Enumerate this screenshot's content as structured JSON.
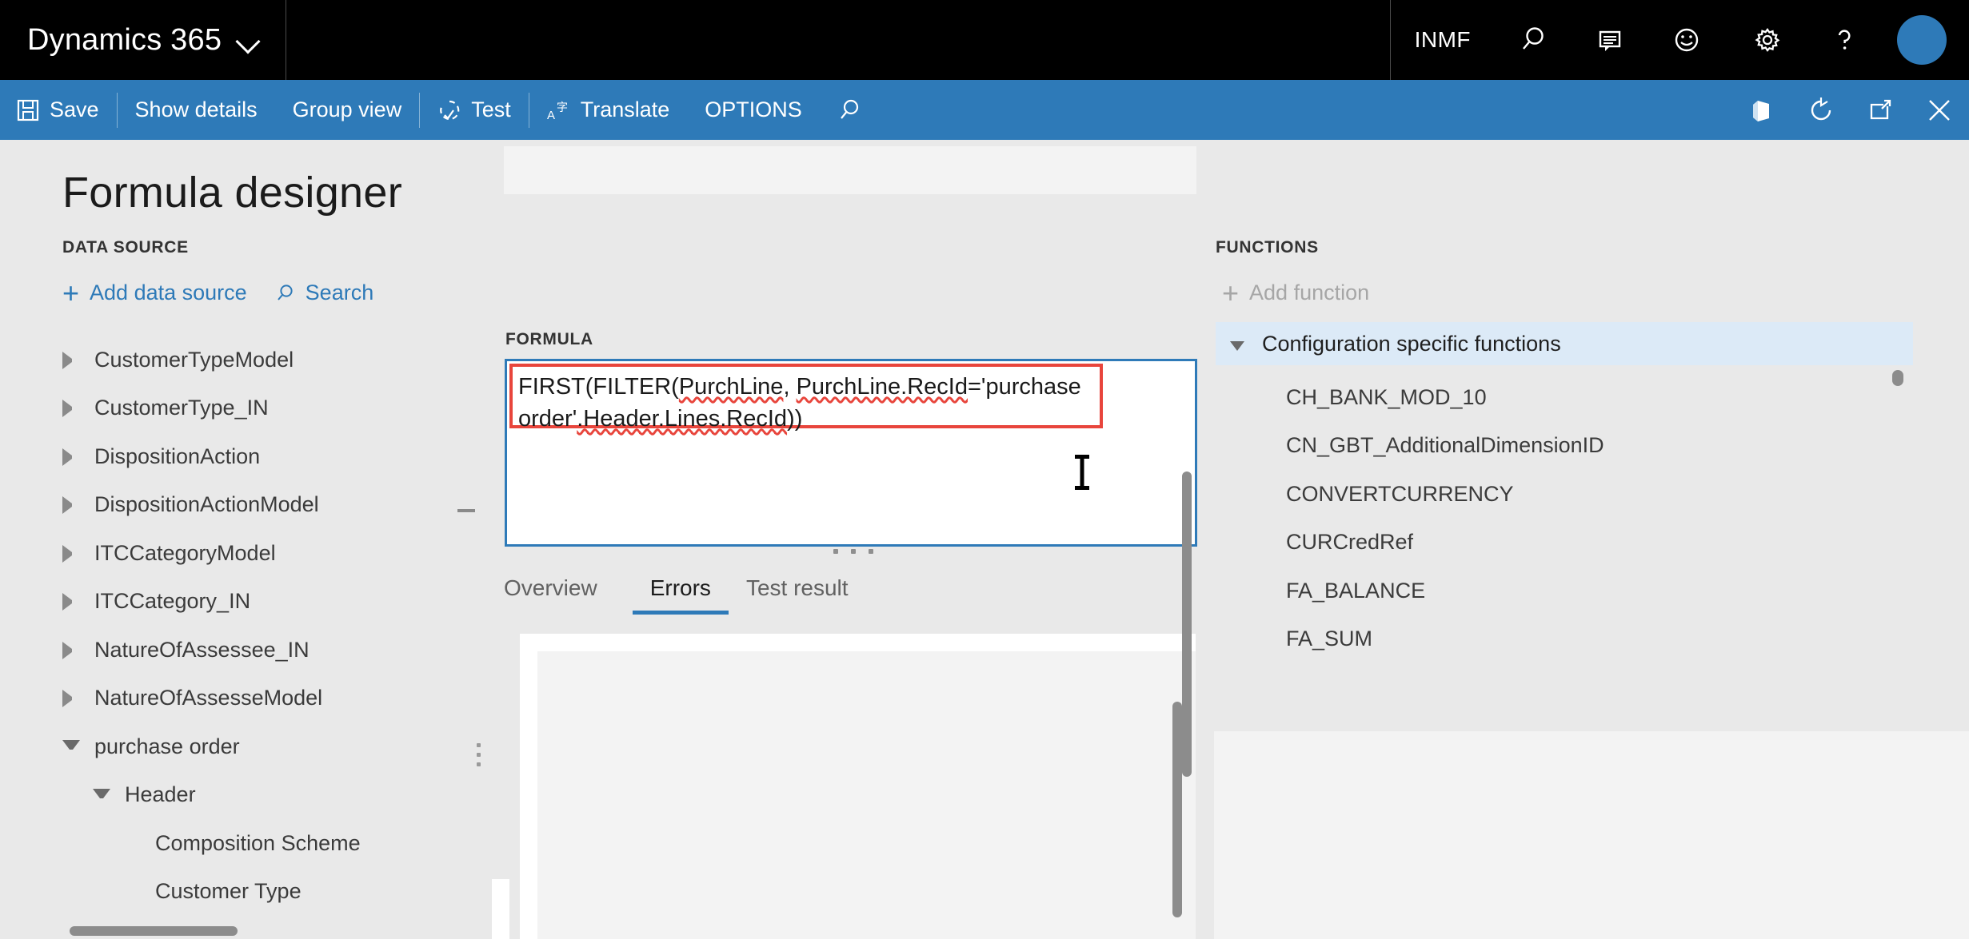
{
  "navbar": {
    "brand": "Dynamics 365",
    "company": "INMF",
    "icons": {
      "brand_chevron": "chevron-down-icon",
      "search": "search-icon",
      "feedback": "message-icon",
      "smiley": "smiley-icon",
      "settings": "gear-icon",
      "help": "question-mark-icon",
      "avatar": "user-avatar"
    }
  },
  "commandbar": {
    "save": "Save",
    "show_details": "Show details",
    "group_view": "Group view",
    "test": "Test",
    "translate": "Translate",
    "options": "OPTIONS",
    "search_icon": "search-icon",
    "office_icon": "office-icon",
    "refresh_icon": "refresh-icon",
    "popout_icon": "pop-out-icon",
    "close_icon": "close-icon"
  },
  "page": {
    "title": "Formula designer"
  },
  "datasource": {
    "section_label": "DATA SOURCE",
    "add_label": "Add data source",
    "search_label": "Search",
    "items": [
      {
        "label": "CustomerTypeModel",
        "indent": 0,
        "state": "collapsed"
      },
      {
        "label": "CustomerType_IN",
        "indent": 0,
        "state": "collapsed"
      },
      {
        "label": "DispositionAction",
        "indent": 0,
        "state": "collapsed"
      },
      {
        "label": "DispositionActionModel",
        "indent": 0,
        "state": "collapsed"
      },
      {
        "label": "ITCCategoryModel",
        "indent": 0,
        "state": "collapsed"
      },
      {
        "label": "ITCCategory_IN",
        "indent": 0,
        "state": "collapsed"
      },
      {
        "label": "NatureOfAssessee_IN",
        "indent": 0,
        "state": "collapsed"
      },
      {
        "label": "NatureOfAssesseModel",
        "indent": 0,
        "state": "collapsed"
      },
      {
        "label": "purchase order",
        "indent": 0,
        "state": "expanded"
      },
      {
        "label": "Header",
        "indent": 1,
        "state": "expanded"
      },
      {
        "label": "Composition Scheme",
        "indent": 2,
        "state": "leaf"
      },
      {
        "label": "Customer Type",
        "indent": 2,
        "state": "leaf"
      }
    ]
  },
  "formula": {
    "label": "FORMULA",
    "segments": [
      {
        "text": "FIRST(FILTER(",
        "squiggle": false
      },
      {
        "text": "PurchLine",
        "squiggle": true
      },
      {
        "text": ", ",
        "squiggle": false
      },
      {
        "text": "PurchLine.RecId",
        "squiggle": true
      },
      {
        "text": "='purchase order'",
        "squiggle": false
      },
      {
        "text": ".Header.Lines.RecId",
        "squiggle": true
      },
      {
        "text": "))",
        "squiggle": false
      }
    ],
    "full_text": "FIRST(FILTER(PurchLine, PurchLine.RecId='purchase order'.Header.Lines.RecId))",
    "error_border_color": "#e8453c",
    "focus_border_color": "#2e7ab8"
  },
  "tabs": [
    {
      "label": "Overview",
      "active": false
    },
    {
      "label": "Errors",
      "active": true
    },
    {
      "label": "Test result",
      "active": false
    }
  ],
  "functions": {
    "section_label": "FUNCTIONS",
    "add_label": "Add function",
    "group_label": "Configuration specific functions",
    "group_state": "expanded",
    "items": [
      "CH_BANK_MOD_10",
      "CN_GBT_AdditionalDimensionID",
      "CONVERTCURRENCY",
      "CURCredRef",
      "FA_BALANCE",
      "FA_SUM"
    ]
  },
  "colors": {
    "nav_bg": "#000000",
    "accent": "#2e7ab8",
    "page_bg": "#e9e9e9",
    "selected_row": "#dceaf7",
    "error": "#e8453c"
  }
}
